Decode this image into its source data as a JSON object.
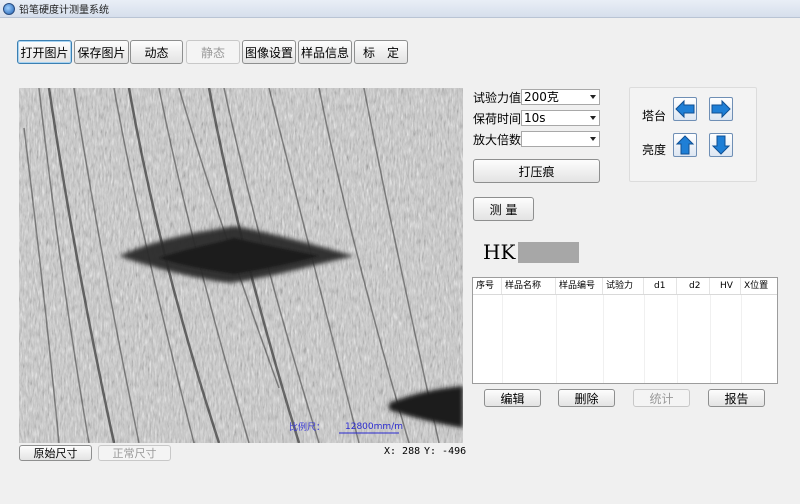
{
  "window": {
    "title": "铅笔硬度计测量系统"
  },
  "toolbar": {
    "open_image": "打开图片",
    "save_image": "保存图片",
    "dynamic": "动态",
    "static": "静态",
    "image_settings": "图像设置",
    "sample_info": "样品信息",
    "calibrate": "标　定"
  },
  "viewer": {
    "scale_label": "比例尺：",
    "scale_value": "12800mm/m",
    "coord_x": "X: 288",
    "coord_y": "Y: -496"
  },
  "bottom_buttons": {
    "original_size": "原始尺寸",
    "normal_size": "正常尺寸"
  },
  "settings": {
    "test_force_label": "试验力值",
    "test_force_value": "200克",
    "hold_time_label": "保荷时间",
    "hold_time_value": "10s",
    "magnification_label": "放大倍数",
    "magnification_value": ""
  },
  "actions": {
    "indent": "打压痕",
    "measure": "测 量"
  },
  "control_panel": {
    "turret_label": "塔台",
    "brightness_label": "亮度"
  },
  "result": {
    "label": "HK",
    "value": ""
  },
  "table": {
    "columns": [
      "序号",
      "样品名称",
      "样品编号",
      "试验力",
      "d1",
      "d2",
      "HV",
      "X位置"
    ],
    "rows": []
  },
  "table_buttons": {
    "edit": "编辑",
    "delete": "删除",
    "stats": "统计",
    "report": "报告"
  },
  "colors": {
    "arrow_blue": "#1f7fd6",
    "titlebar": "#d6dfec"
  }
}
